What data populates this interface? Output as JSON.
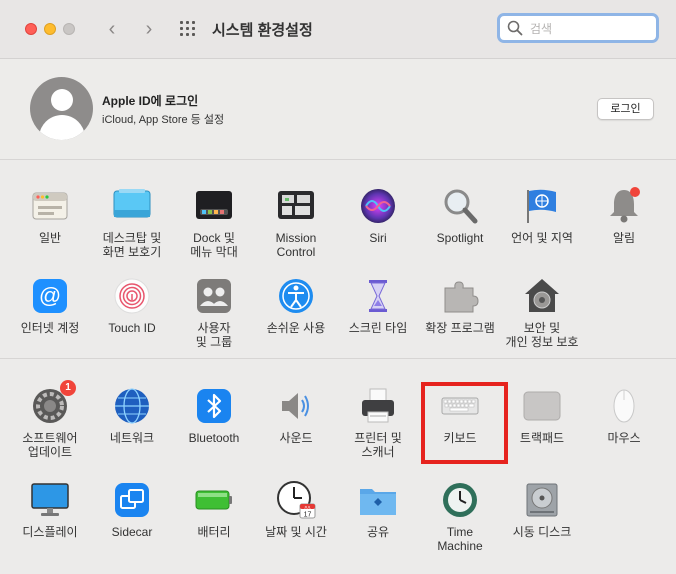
{
  "window": {
    "title": "시스템 환경설정",
    "search_placeholder": "검색"
  },
  "apple_id": {
    "title": "Apple ID에 로그인",
    "subtitle": "iCloud, App Store 등 설정",
    "login_label": "로그인"
  },
  "panes": [
    {
      "label": "일반"
    },
    {
      "label": "데스크탑 및\n화면 보호기"
    },
    {
      "label": "Dock 및\n메뉴 막대"
    },
    {
      "label": "Mission\nControl"
    },
    {
      "label": "Siri"
    },
    {
      "label": "Spotlight"
    },
    {
      "label": "언어 및 지역"
    },
    {
      "label": "알림"
    },
    {
      "label": "인터넷 계정"
    },
    {
      "label": "Touch ID"
    },
    {
      "label": "사용자\n및 그룹"
    },
    {
      "label": "손쉬운 사용"
    },
    {
      "label": "스크린 타임"
    },
    {
      "label": "확장 프로그램"
    },
    {
      "label": "보안 및\n개인 정보 보호"
    },
    {
      "label": "소프트웨어\n업데이트",
      "badge": "1"
    },
    {
      "label": "네트워크"
    },
    {
      "label": "Bluetooth"
    },
    {
      "label": "사운드"
    },
    {
      "label": "프린터 및\n스캐너"
    },
    {
      "label": "키보드"
    },
    {
      "label": "트랙패드"
    },
    {
      "label": "마우스"
    },
    {
      "label": "디스플레이"
    },
    {
      "label": "Sidecar"
    },
    {
      "label": "배터리"
    },
    {
      "label": "날짜 및 시간"
    },
    {
      "label": "공유"
    },
    {
      "label": "Time\nMachine"
    },
    {
      "label": "시동 디스크"
    }
  ],
  "clock_icon": {
    "month": "JUL",
    "day": "17"
  },
  "colors": {
    "highlight": "#e6231e",
    "accent": "#8fb5e6"
  }
}
